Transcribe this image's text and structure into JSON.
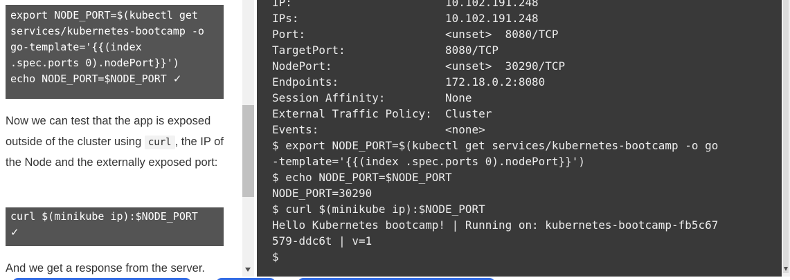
{
  "left_panel": {
    "code_block_1": [
      "export NODE_PORT=$(kubectl get",
      "services/kubernetes-bootcamp -o",
      "go-template='{{(index",
      ".spec.ports 0).nodePort}}')",
      "echo NODE_PORT=$NODE_PORT"
    ],
    "check_mark": "✓",
    "prose_1": {
      "before_code": "Now we can test that the app is exposed outside of the cluster using ",
      "inline_code": "curl",
      "after_code": ", the IP of the Node and the externally exposed port:"
    },
    "code_block_2": "curl $(minikube ip):$NODE_PORT",
    "prose_2": "And we get a response from the server."
  },
  "terminal": {
    "lines": [
      "IP:                       10.102.191.248",
      "IPs:                      10.102.191.248",
      "Port:                     <unset>  8080/TCP",
      "TargetPort:               8080/TCP",
      "NodePort:                 <unset>  30290/TCP",
      "Endpoints:                172.18.0.2:8080",
      "Session Affinity:         None",
      "External Traffic Policy:  Cluster",
      "Events:                   <none>",
      "$ export NODE_PORT=$(kubectl get services/kubernetes-bootcamp -o go",
      "-template='{{(index .spec.ports 0).nodePort}}')",
      "$ echo NODE_PORT=$NODE_PORT",
      "NODE_PORT=30290",
      "$ curl $(minikube ip):$NODE_PORT",
      "Hello Kubernetes bootcamp! | Running on: kubernetes-bootcamp-fb5c67",
      "579-ddc6t | v=1",
      "$"
    ]
  },
  "colors": {
    "terminal_bg": "#393939",
    "terminal_fg": "#ececec",
    "code_block_bg": "#545454",
    "accent_blue": "#326ce5"
  },
  "icons": {
    "scroll_down": "chevron-down-icon",
    "check": "check-icon"
  }
}
